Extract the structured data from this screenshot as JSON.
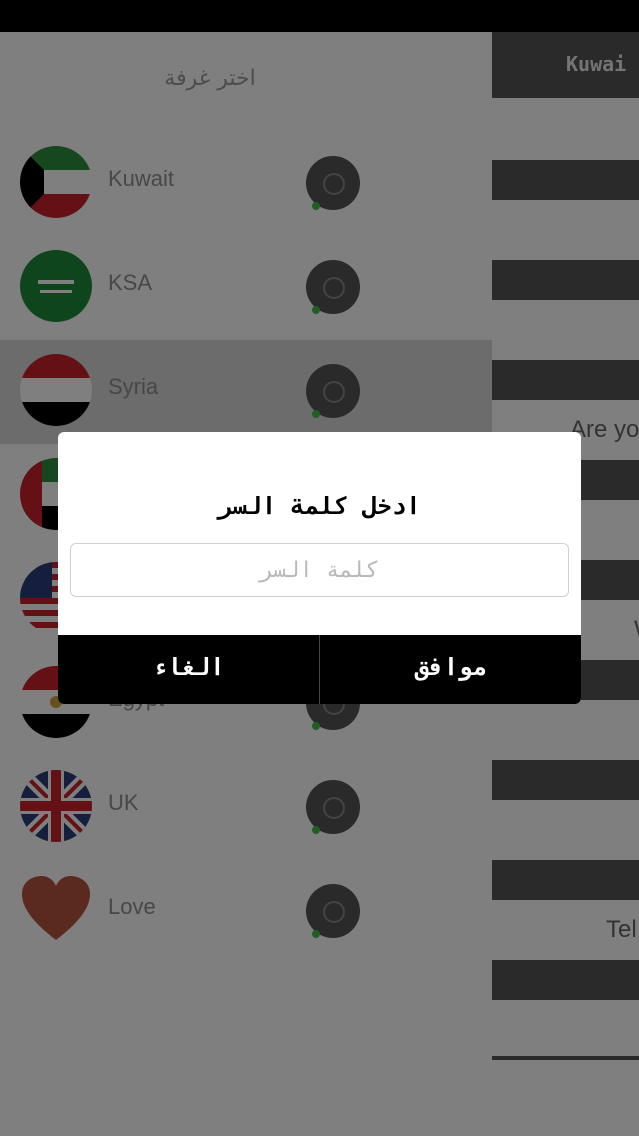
{
  "drawer": {
    "title": "اختر غرفة",
    "items": [
      {
        "label": "Kuwait",
        "icon": "kuwait-flag-icon"
      },
      {
        "label": "KSA",
        "icon": "saudi-flag-icon"
      },
      {
        "label": "Syria",
        "icon": "syria-flag-icon"
      },
      {
        "label": "",
        "icon": "uae-flag-icon"
      },
      {
        "label": "",
        "icon": "usa-flag-icon"
      },
      {
        "label": "Egypt",
        "icon": "egypt-flag-icon"
      },
      {
        "label": "UK",
        "icon": "uk-flag-icon"
      },
      {
        "label": "Love",
        "icon": "heart-icon"
      }
    ]
  },
  "main": {
    "header_title": "Kuwai",
    "text_1": "Are yo",
    "text_2": "W",
    "text_3": "Tel"
  },
  "dialog": {
    "title": "ادخل كلمة السر",
    "input_value": "",
    "input_placeholder": "كلمة السر",
    "ok_label": "موافق",
    "cancel_label": "الغاء"
  },
  "colors": {
    "overlay": "#00000080",
    "dialog_buttons_bg": "#000000",
    "header_bg": "#555555"
  }
}
